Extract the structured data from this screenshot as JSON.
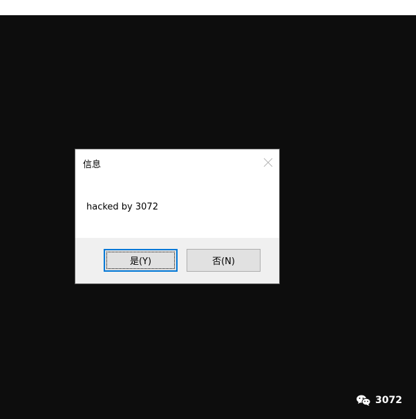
{
  "dialog": {
    "title": "信息",
    "message": "hacked by 3072",
    "buttons": {
      "yes_label": "是(Y)",
      "no_label": "否(N)"
    },
    "close_icon": "close-icon"
  },
  "watermark": {
    "icon": "wechat-icon",
    "text": "3072"
  },
  "colors": {
    "background_dark": "#0d0d0d",
    "dialog_bg": "#ffffff",
    "button_area_bg": "#f0f0f0",
    "button_bg": "#e1e1e1",
    "focus_accent": "#0078d7"
  }
}
